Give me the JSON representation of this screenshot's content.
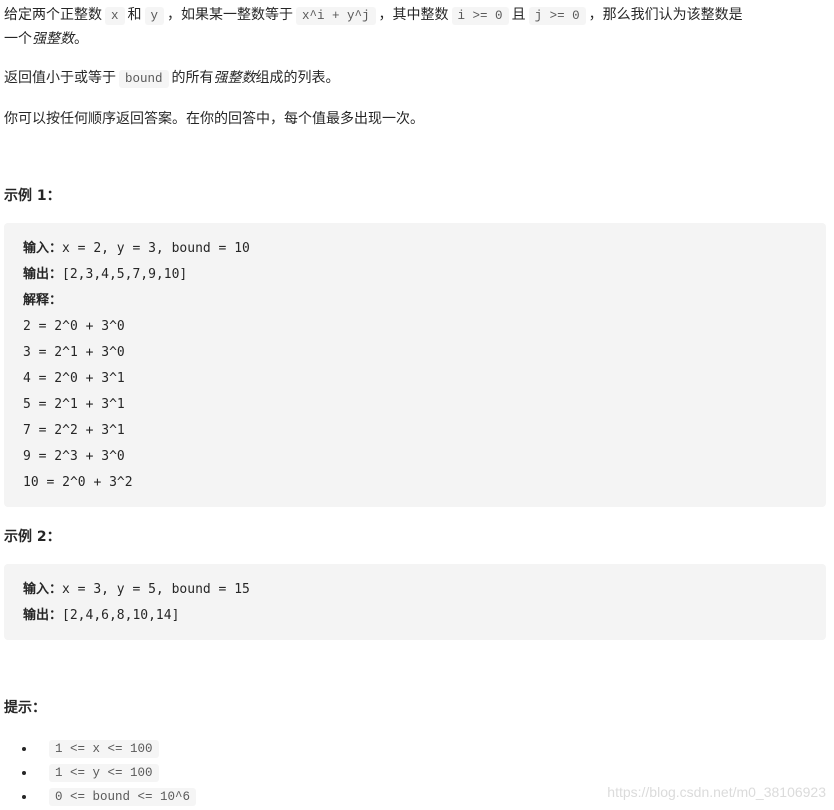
{
  "intro": {
    "p1": {
      "t1": "给定两个正整数",
      "c1": "x",
      "t2": "和",
      "c2": "y",
      "t3": "，如果某一整数等于",
      "c3": "x^i + y^j",
      "t4": "，其中整数",
      "c4": "i >= 0",
      "t5": "且",
      "c5": "j >= 0",
      "t6": "，那么我们认为该整数是",
      "line2_prefix": "一个",
      "line2_em": "强整数",
      "line2_suffix": "。"
    },
    "p2": {
      "t1": "返回值小于或等于",
      "c1": "bound",
      "t2": "的所有",
      "em": "强整数",
      "t3": "组成的列表。"
    },
    "p3": "你可以按任何顺序返回答案。在你的回答中，每个值最多出现一次。"
  },
  "examples": [
    {
      "heading": "示例 1：",
      "input_label": "输入：",
      "input": "x = 2, y = 3, bound = 10",
      "output_label": "输出：",
      "output": "[2,3,4,5,7,9,10]",
      "explain_label": "解释：",
      "explanation": [
        "2 = 2^0 + 3^0",
        "3 = 2^1 + 3^0",
        "4 = 2^0 + 3^1",
        "5 = 2^1 + 3^1",
        "7 = 2^2 + 3^1",
        "9 = 2^3 + 3^0",
        "10 = 2^0 + 3^2"
      ]
    },
    {
      "heading": "示例 2：",
      "input_label": "输入：",
      "input": "x = 3, y = 5, bound = 15",
      "output_label": "输出：",
      "output": "[2,4,6,8,10,14]"
    }
  ],
  "hints": {
    "heading": "提示：",
    "items": [
      "1 <= x <= 100",
      "1 <= y  <= 100",
      "0 <= bound  <= 10^6"
    ]
  },
  "watermark": "https://blog.csdn.net/m0_38106923"
}
